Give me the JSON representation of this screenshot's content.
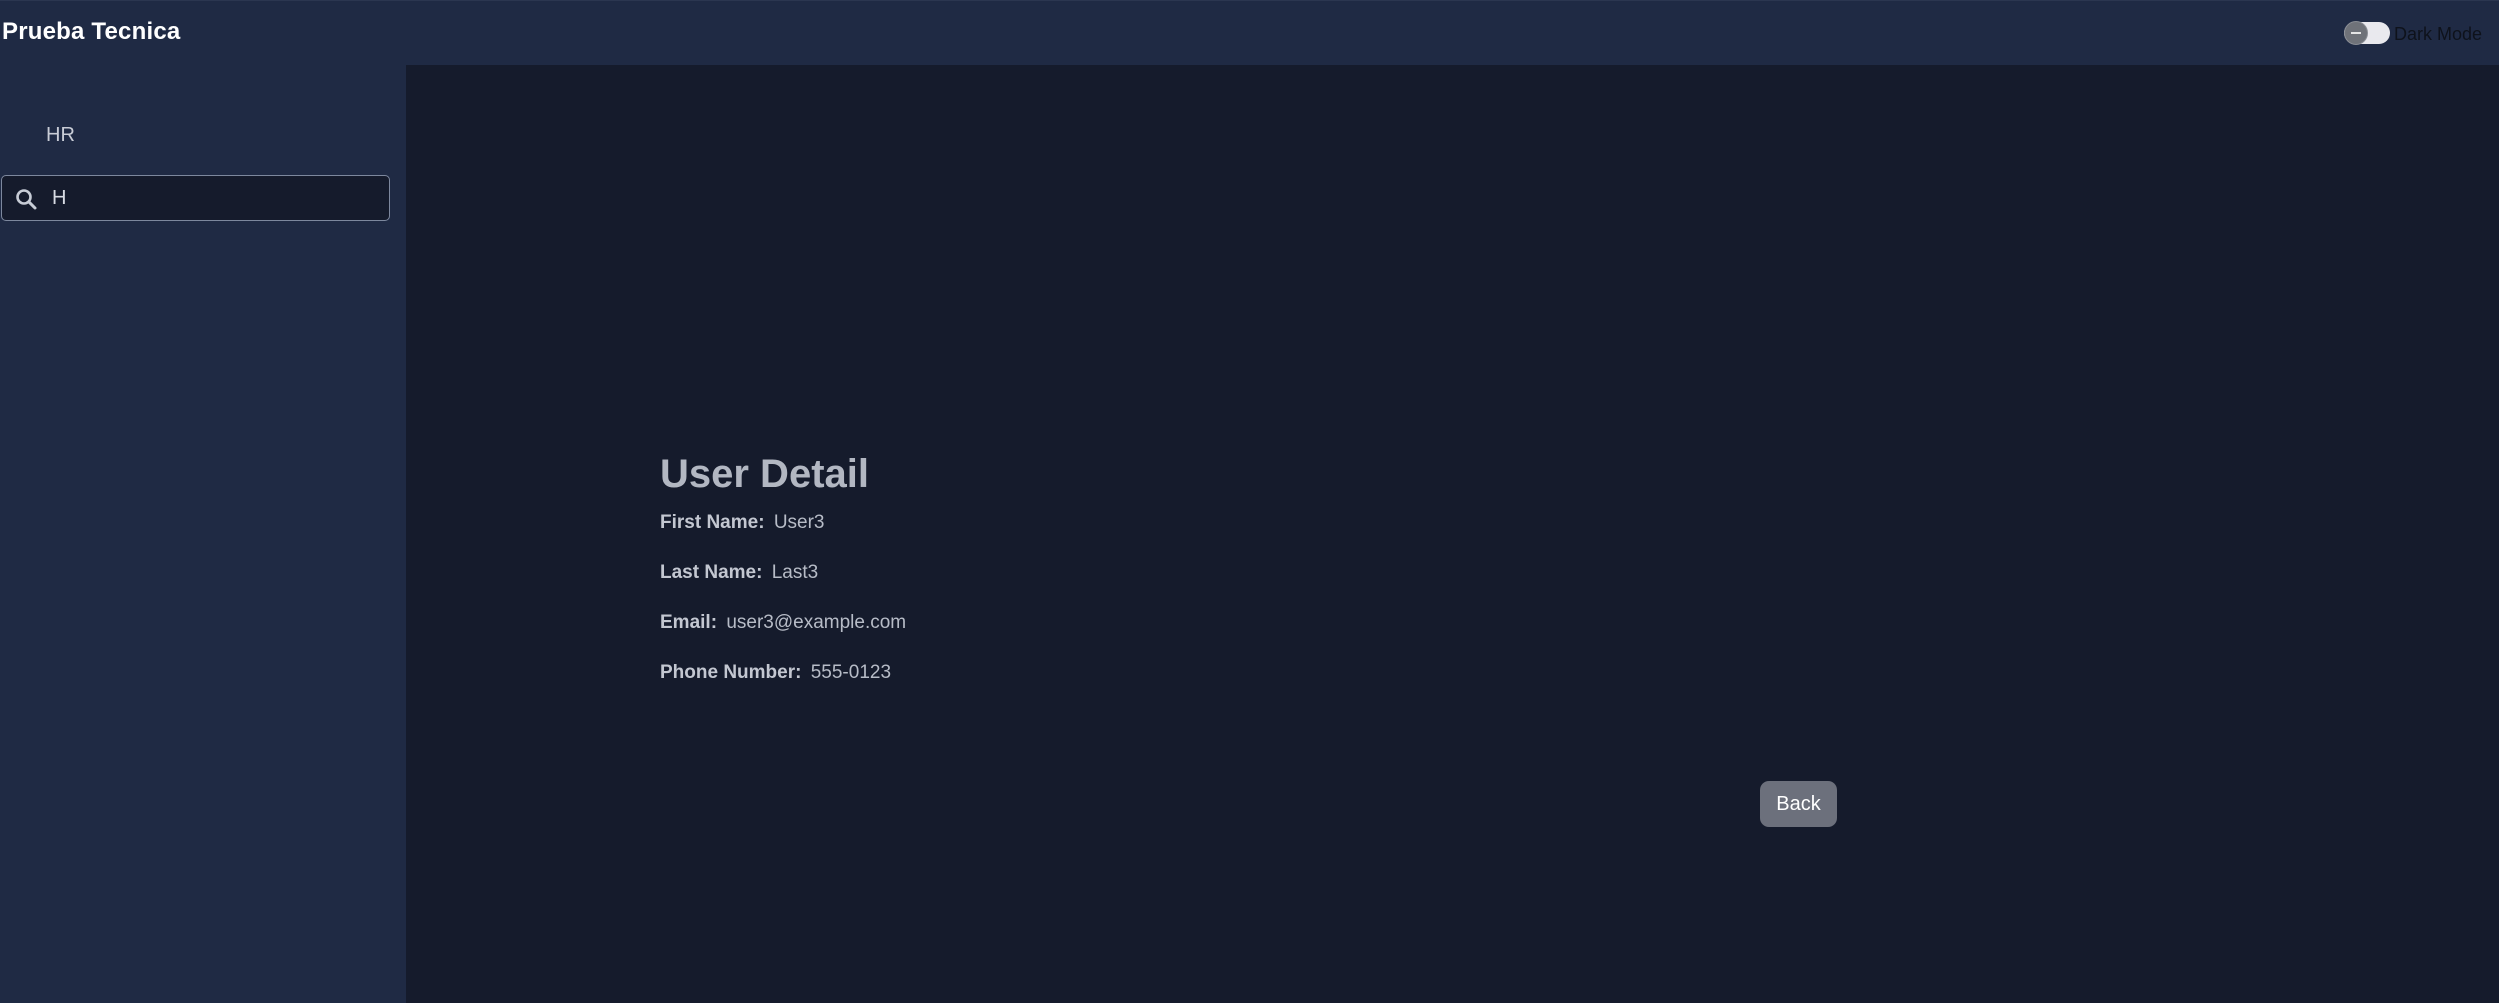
{
  "header": {
    "title": "Prueba Tecnica",
    "dark_mode_label": "Dark Mode",
    "dark_mode_on": false
  },
  "sidebar": {
    "items": [
      {
        "label": "HR"
      }
    ],
    "search": {
      "value": "H",
      "placeholder": "",
      "icon": "search-icon"
    }
  },
  "detail": {
    "title": "User Detail",
    "fields": [
      {
        "label": "First Name:",
        "value": "User3"
      },
      {
        "label": "Last Name:",
        "value": "Last3"
      },
      {
        "label": "Email:",
        "value": "user3@example.com"
      },
      {
        "label": "Phone Number:",
        "value": "555-0123"
      }
    ],
    "back_label": "Back"
  },
  "colors": {
    "topbar": "#1f2a44",
    "sidebar": "#1f2a44",
    "main_bg": "#151b2c",
    "back_button": "#6c707c"
  }
}
